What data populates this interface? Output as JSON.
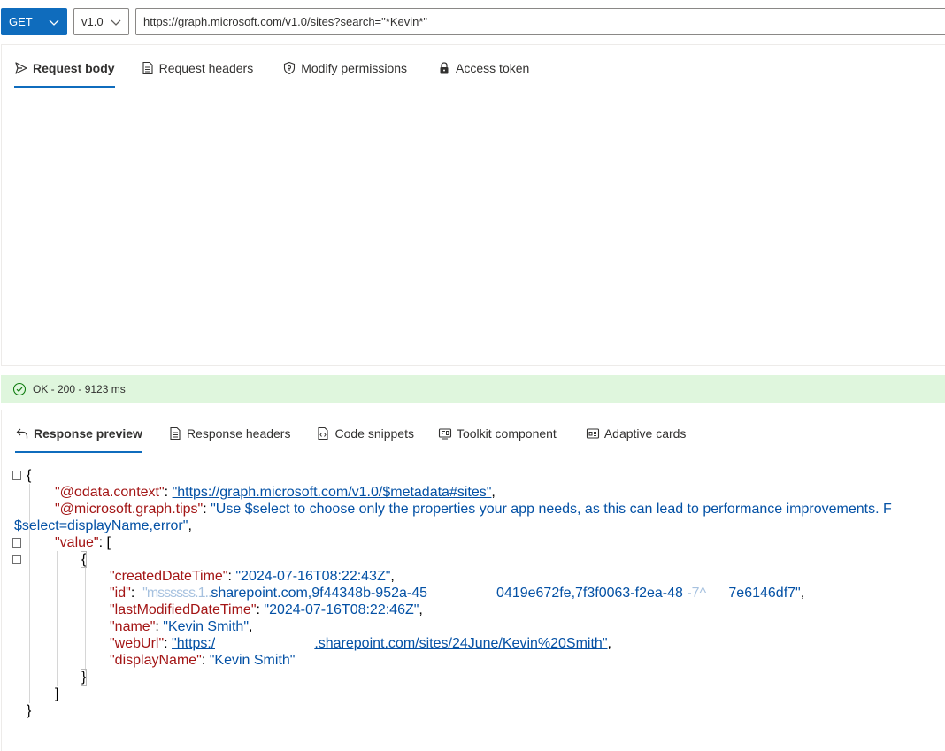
{
  "query": {
    "method": "GET",
    "version": "v1.0",
    "url": "https://graph.microsoft.com/v1.0/sites?search=\"*Kevin*\""
  },
  "request_tabs": [
    {
      "label": "Request body",
      "icon": "send-icon",
      "active": true
    },
    {
      "label": "Request headers",
      "icon": "document-icon",
      "active": false
    },
    {
      "label": "Modify permissions",
      "icon": "shield-icon",
      "active": false
    },
    {
      "label": "Access token",
      "icon": "lock-icon",
      "active": false
    }
  ],
  "status": {
    "text": "OK - 200 - 9123 ms",
    "color": "#dff6dd",
    "icon": "check-circle-icon"
  },
  "response_tabs": [
    {
      "label": "Response preview",
      "icon": "undo-arrow-icon",
      "active": true
    },
    {
      "label": "Response headers",
      "icon": "document-icon",
      "active": false
    },
    {
      "label": "Code snippets",
      "icon": "code-file-icon",
      "active": false
    },
    {
      "label": "Toolkit component",
      "icon": "toolkit-icon",
      "active": false
    },
    {
      "label": "Adaptive cards",
      "icon": "card-icon",
      "active": false
    }
  ],
  "response": {
    "odata_context_key": "\"@odata.context\"",
    "odata_context_val": "\"https://graph.microsoft.com/v1.0/$metadata#sites\"",
    "tips_key": "\"@microsoft.graph.tips\"",
    "tips_val_1": "\"Use $select to choose only the properties your app needs, as this can lead to performance improvements. F",
    "tips_val_2": "$select=displayName,error\"",
    "value_key": "\"value\"",
    "created_key": "\"createdDateTime\"",
    "created_val": "\"2024-07-16T08:22:43Z\"",
    "id_key": "\"id\"",
    "id_val_a": "sharepoint.com,9f44348b-952a-45",
    "id_val_b": "0419e672fe,7f3f0063-f2ea-48",
    "id_val_c": "7e6146df7\"",
    "modified_key": "\"lastModifiedDateTime\"",
    "modified_val": "\"2024-07-16T08:22:46Z\"",
    "name_key": "\"name\"",
    "name_val": "\"Kevin Smith\"",
    "weburl_key": "\"webUrl\"",
    "weburl_val_a": "\"https:/",
    "weburl_val_b": ".sharepoint.com/sites/24June/Kevin%20Smith\"",
    "display_key": "\"displayName\"",
    "display_val": "\"Kevin Smith\""
  }
}
